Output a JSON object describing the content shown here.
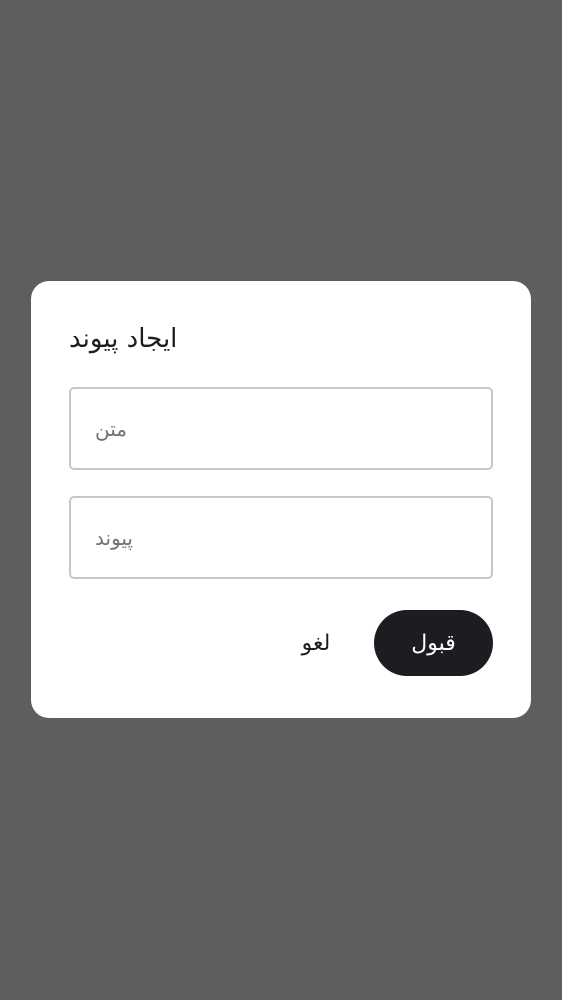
{
  "dialog": {
    "title": "ایجاد پیوند",
    "fields": {
      "text": {
        "placeholder": "متن",
        "value": ""
      },
      "link": {
        "placeholder": "پیوند",
        "value": ""
      }
    },
    "actions": {
      "accept_label": "قبول",
      "cancel_label": "لغو"
    }
  },
  "colors": {
    "backdrop": "#5e5e5e",
    "dialog_background": "#ffffff",
    "primary_button": "#1c1d21",
    "field_border": "#c6c7cb",
    "placeholder": "#6f7177"
  }
}
